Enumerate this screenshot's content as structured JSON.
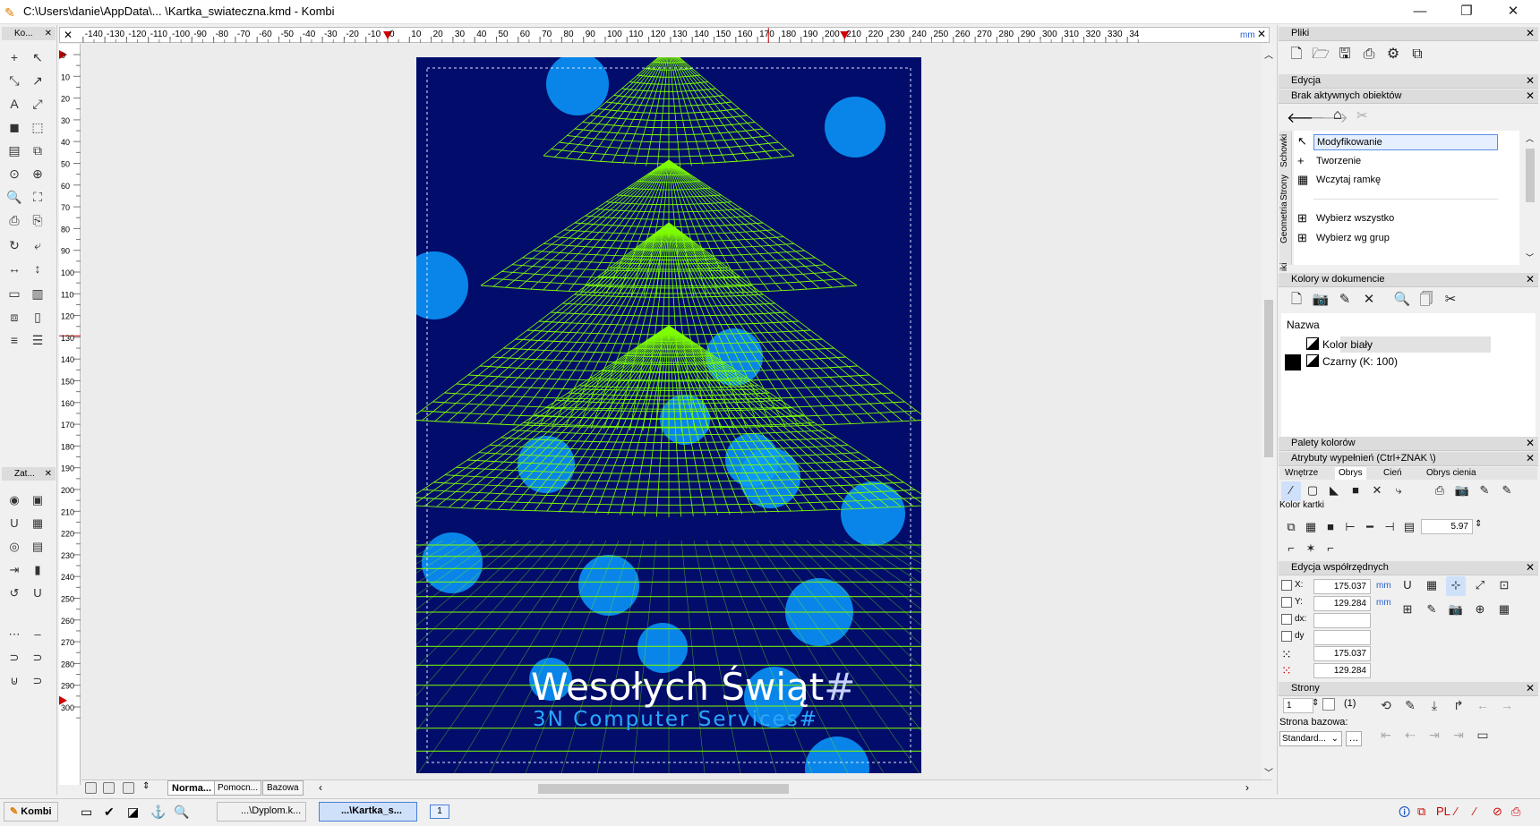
{
  "window": {
    "title": "C:\\Users\\danie\\AppData\\... \\Kartka_swiateczna.kmd - Kombi",
    "min": "—",
    "max": "❐",
    "close": "✕"
  },
  "left_toolbar": {
    "title": "Ko...",
    "zoom_title": "Zat..."
  },
  "ruler": {
    "unit": "mm",
    "h_ticks": [
      "-140",
      "-130",
      "-120",
      "-110",
      "-100",
      "-90",
      "-80",
      "-70",
      "-60",
      "-50",
      "-40",
      "-30",
      "-20",
      "-10",
      "0",
      "10",
      "20",
      "30",
      "40",
      "50",
      "60",
      "70",
      "80",
      "90",
      "100",
      "110",
      "120",
      "130",
      "140",
      "150",
      "160",
      "170",
      "180",
      "190",
      "200",
      "210",
      "220",
      "230",
      "240",
      "250",
      "260",
      "270",
      "280",
      "290",
      "300",
      "310",
      "320",
      "330",
      "34"
    ],
    "v_ticks": [
      "0",
      "10",
      "20",
      "30",
      "40",
      "50",
      "60",
      "70",
      "80",
      "90",
      "100",
      "110",
      "120",
      "130",
      "140",
      "150",
      "160",
      "170",
      "180",
      "190",
      "200",
      "210",
      "220",
      "230",
      "240",
      "250",
      "260",
      "270",
      "280",
      "290",
      "300"
    ]
  },
  "card": {
    "greeting": "Wesołych Świąt",
    "greeting_mark": "#",
    "company": "3N Computer Services",
    "company_mark": "#",
    "bg_color": "#020d6b",
    "tree_color": "#7fff00",
    "bokeh_color": "#0a9bff"
  },
  "bottom_tabs": [
    "Norma...",
    "Pomocn...",
    "Bazowa"
  ],
  "taskbar": {
    "app": "Kombi",
    "docs": [
      "...\\Dyplom.k...",
      "...\\Kartka_s..."
    ],
    "page_btn": "1"
  },
  "panels": {
    "pliki": "Pliki",
    "edycja": "Edycja",
    "brak": "Brak aktywnych obiektów",
    "side_tabs": [
      "Schowki",
      "Strony",
      "Geometria",
      "iki"
    ],
    "modes": [
      "Modyfikowanie",
      "Tworzenie",
      "Wczytaj ramkę",
      "Wybierz wszystko",
      "Wybierz wg grup"
    ],
    "kolory": "Kolory w dokumencie",
    "kolory_header": "Nazwa",
    "colors": [
      {
        "name": "Kolor biały"
      },
      {
        "name": "Czarny (K: 100)"
      }
    ],
    "palety": "Palety kolorów",
    "atrybuty": "Atrybuty wypełnień (Ctrl+ZNAK \\)",
    "atrybuty_tabs": [
      "Wnętrze",
      "Obrys",
      "Cień",
      "Obrys cienia"
    ],
    "kolor_kartki": "Kolor kartki",
    "line_width": "5.97",
    "edycja_wsp": "Edycja współrzędnych",
    "coords": {
      "x_label": "X:",
      "x": "175.037",
      "y_label": "Y:",
      "y": "129.284",
      "dx_label": "dx:",
      "dy_label": "dy",
      "unit": "mm",
      "x2": "175.037",
      "y2": "129.284"
    },
    "strony": "Strony",
    "page_num": "1",
    "page_count": "(1)",
    "strona_bazowa": "Strona bazowa:",
    "strona_bazowa_val": "Standard..."
  }
}
